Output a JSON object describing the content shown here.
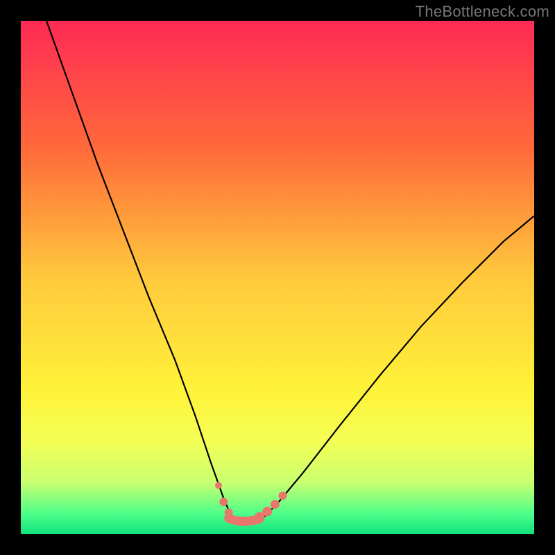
{
  "attribution": "TheBottleneck.com",
  "chart_data": {
    "type": "line",
    "title": "",
    "xlabel": "",
    "ylabel": "",
    "xlim": [
      0,
      100
    ],
    "ylim": [
      0,
      100
    ],
    "grid": false,
    "legend": false,
    "gradient_stops": [
      {
        "offset": 0,
        "color": "#ff2a55"
      },
      {
        "offset": 25,
        "color": "#ff6a3a"
      },
      {
        "offset": 50,
        "color": "#ffc93c"
      },
      {
        "offset": 72,
        "color": "#fff23a"
      },
      {
        "offset": 82,
        "color": "#f4ff55"
      },
      {
        "offset": 90,
        "color": "#c8ff70"
      },
      {
        "offset": 96,
        "color": "#4dff8a"
      },
      {
        "offset": 100,
        "color": "#11e27d"
      }
    ],
    "series": [
      {
        "name": "bottleneck-curve",
        "x": [
          5,
          10,
          15,
          20,
          25,
          30,
          34,
          37,
          39.5,
          41,
          43,
          45,
          47,
          50,
          55,
          62,
          70,
          78,
          86,
          94,
          100
        ],
        "values": [
          100,
          86,
          72,
          59,
          46,
          34,
          23,
          14,
          7,
          3.5,
          2.5,
          2.5,
          3,
          6,
          12,
          21,
          31,
          40.5,
          49,
          57,
          62
        ]
      }
    ],
    "markers": {
      "name": "bottom-markers",
      "x": [
        38.5,
        39.5,
        40.5,
        46.5,
        48,
        49.5,
        51
      ],
      "values": [
        9.5,
        6.3,
        4.2,
        3.3,
        4.4,
        5.8,
        7.5
      ],
      "radii": [
        5,
        6,
        6,
        7.5,
        7,
        6.5,
        6
      ]
    },
    "flat_segment": {
      "name": "flat-bottom",
      "x": [
        40.5,
        42,
        43.5,
        45,
        46.5
      ],
      "values": [
        3.1,
        2.6,
        2.5,
        2.6,
        3.0
      ]
    },
    "colors": {
      "curve": "#000000",
      "markers": "#e8766d",
      "flat": "#e8766d"
    }
  }
}
